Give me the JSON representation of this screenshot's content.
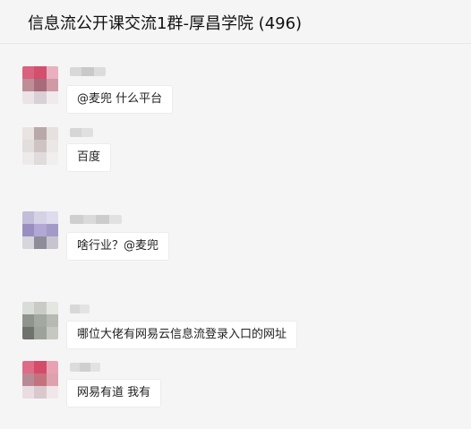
{
  "chat": {
    "title": "信息流公开课交流1群-厚昌学院 (496)"
  },
  "messages": [
    {
      "text": "@麦兜 什么平台",
      "avatar_colors": [
        "#d9627e",
        "#d34f6e",
        "#e9b0bf",
        "#bf8d98",
        "#a86b7a",
        "#cf9aa6",
        "#ebe3e6",
        "#d8d0d4",
        "#f0eaec"
      ],
      "nick_colors": [
        "#d8d8d8",
        "#c9c9c9",
        "#dcdcdc"
      ]
    },
    {
      "text": "百度",
      "avatar_colors": [
        "#e9e4e2",
        "#b8a8a8",
        "#e6e0df",
        "#e2dedd",
        "#cfc4c3",
        "#ebe7e6",
        "#eeeaea",
        "#e0dcdc",
        "#f0eeee"
      ],
      "nick_colors": [
        "#d6d6d6",
        "#e0e0e0"
      ]
    },
    {
      "text": "啥行业？@麦兜",
      "avatar_colors": [
        "#c2bdd8",
        "#d6d2e6",
        "#dedbed",
        "#9a8ec0",
        "#b3a7d6",
        "#a49ac8",
        "#d6d6dc",
        "#8e8c99",
        "#c7c4cf"
      ],
      "nick_colors": [
        "#cfcfcf",
        "#dadada",
        "#cccccc",
        "#e1e1e1"
      ]
    },
    {
      "text": "哪位大佬有网易云信息流登录入口的网址",
      "avatar_colors": [
        "#d9dcd8",
        "#c9ccc6",
        "#e4e6e2",
        "#8f948d",
        "#a3a8a0",
        "#b6bab2",
        "#6f726d",
        "#9ea39a",
        "#c4c8c0"
      ],
      "nick_colors": [
        "#d8d8d8",
        "#e3e3e3"
      ]
    },
    {
      "text": "网易有道 我有",
      "avatar_colors": [
        "#df6c86",
        "#d44c6a",
        "#e7a3b3",
        "#b98a95",
        "#c5727f",
        "#dda2ae",
        "#e9dde1",
        "#d9c9ce",
        "#efe7e9"
      ],
      "nick_colors": [
        "#dcdcdc",
        "#cfcfcf",
        "#e2e2e2"
      ]
    }
  ]
}
